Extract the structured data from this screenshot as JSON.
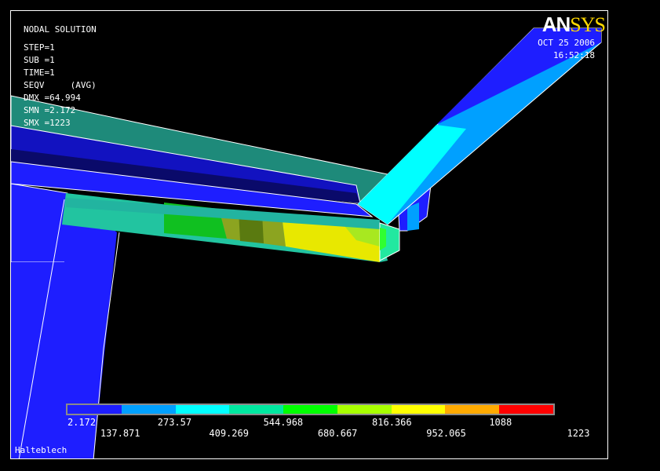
{
  "plot": {
    "title": "NODAL SOLUTION",
    "lines": [
      "STEP=1",
      "SUB =1",
      "TIME=1",
      "SEQV     (AVG)",
      "DMX =64.994",
      "SMN =2.172",
      "SMX =1223"
    ]
  },
  "brand": {
    "an": "AN",
    "sys": "SYS"
  },
  "timestamp": {
    "date": "OCT 25 2006",
    "time": "16:52:18"
  },
  "legend": {
    "colors": [
      "#1e1eff",
      "#00a0ff",
      "#00ffff",
      "#00e8a0",
      "#00ff00",
      "#a8ff00",
      "#ffff00",
      "#ffaa00",
      "#ff0000"
    ],
    "labels_top": [
      "2.172",
      "273.57",
      "544.968",
      "816.366",
      "1088"
    ],
    "labels_bottom": [
      "137.871",
      "409.269",
      "680.667",
      "952.065",
      "1223"
    ]
  },
  "footer": {
    "label": "Halteblech"
  }
}
